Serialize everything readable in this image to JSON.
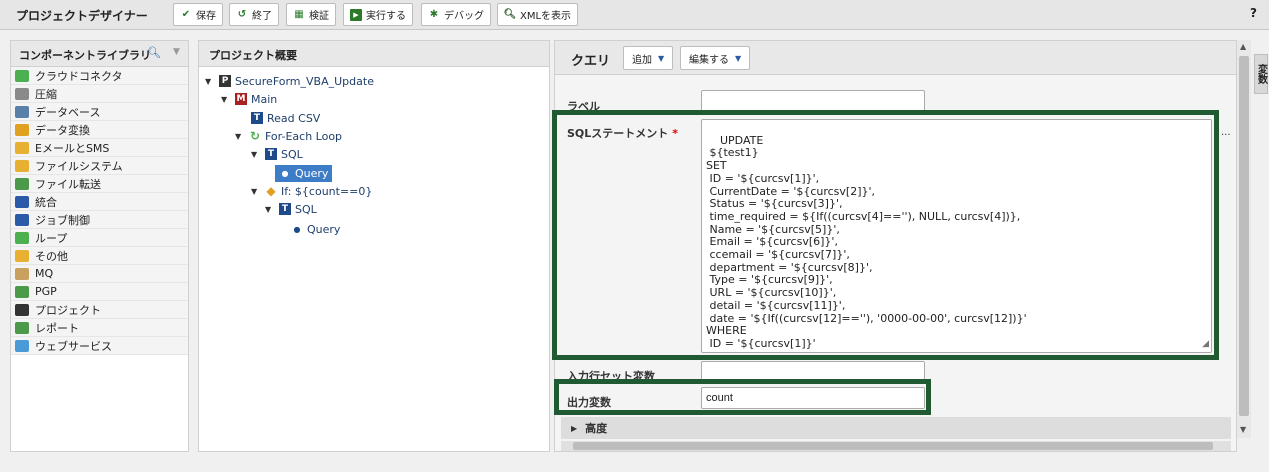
{
  "app_title": "プロジェクトデザイナー",
  "toolbar": {
    "save": "保存",
    "exit": "終了",
    "verify": "検証",
    "run": "実行する",
    "debug": "デバッグ",
    "show_xml": "XMLを表示",
    "help": "?"
  },
  "library": {
    "title": "コンポーネントライブラリ",
    "items": [
      {
        "label": "クラウドコネクタ",
        "icon": "cloud-icon",
        "color": "#4caf50"
      },
      {
        "label": "圧縮",
        "icon": "compress-icon",
        "color": "#8a8a8a"
      },
      {
        "label": "データベース",
        "icon": "database-icon",
        "color": "#5a7fa8"
      },
      {
        "label": "データ変換",
        "icon": "transform-icon",
        "color": "#e0a020"
      },
      {
        "label": "EメールとSMS",
        "icon": "mail-icon",
        "color": "#e8b030"
      },
      {
        "label": "ファイルシステム",
        "icon": "folder-icon",
        "color": "#e8b030"
      },
      {
        "label": "ファイル転送",
        "icon": "file-transfer-icon",
        "color": "#4a9a4a"
      },
      {
        "label": "統合",
        "icon": "integration-icon",
        "color": "#2a5aa8"
      },
      {
        "label": "ジョブ制御",
        "icon": "gear-icon",
        "color": "#2a5aa8"
      },
      {
        "label": "ループ",
        "icon": "loop-icon",
        "color": "#4caf50"
      },
      {
        "label": "その他",
        "icon": "misc-folder-icon",
        "color": "#e8b030"
      },
      {
        "label": "MQ",
        "icon": "mq-icon",
        "color": "#c8a060"
      },
      {
        "label": "PGP",
        "icon": "lock-icon",
        "color": "#4a9a4a"
      },
      {
        "label": "プロジェクト",
        "icon": "project-icon",
        "color": "#333333"
      },
      {
        "label": "レポート",
        "icon": "report-icon",
        "color": "#4a9a4a"
      },
      {
        "label": "ウェブサービス",
        "icon": "web-service-icon",
        "color": "#4a9ad8"
      }
    ]
  },
  "overview": {
    "title": "プロジェクト概要",
    "nodes": {
      "root": "SecureForm_VBA_Update",
      "main": "Main",
      "read_csv": "Read CSV",
      "foreach": "For-Each Loop",
      "sql1": "SQL",
      "query1": "Query",
      "if": "If: ${count==0}",
      "sql2": "SQL",
      "query2": "Query"
    }
  },
  "query": {
    "title": "クエリ",
    "add_label": "追加",
    "edit_label": "編集する",
    "label_field": "ラベル",
    "label_value": "",
    "sql_label": "SQLステートメント",
    "required_mark": "*",
    "sql_value": "UPDATE\n ${test1}\nSET\n ID = '${curcsv[1]}',\n CurrentDate = '${curcsv[2]}',\n Status = '${curcsv[3]}',\n time_required = ${If((curcsv[4]==''), NULL, curcsv[4])},\n Name = '${curcsv[5]}',\n Email = '${curcsv[6]}',\n ccemail = '${curcsv[7]}',\n department = '${curcsv[8]}',\n Type = '${curcsv[9]}',\n URL = '${curcsv[10]}',\n detail = '${curcsv[11]}',\n date = '${If((curcsv[12]==''), '0000-00-00', curcsv[12])}'\nWHERE\n ID = '${curcsv[1]}'",
    "more_label": "...",
    "input_rowset_label": "入力行セット変数",
    "input_rowset_value": "",
    "output_var_label": "出力変数",
    "output_var_value": "count",
    "advanced_label": "高度"
  },
  "side_tab": "変数",
  "colors": {
    "highlight": "#1f5a33",
    "selection": "#3d7dc8"
  }
}
